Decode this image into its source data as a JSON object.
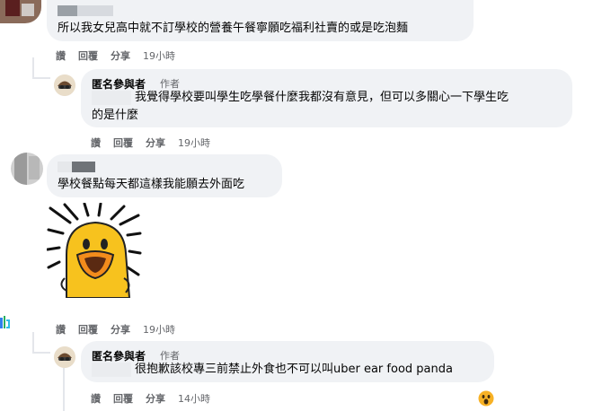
{
  "comments": [
    {
      "text": "所以我女兒高中就不訂學校的營養午餐寧願吃福利社賣的或是吃泡麵",
      "actions": {
        "like": "讚",
        "reply": "回覆",
        "share": "分享"
      },
      "time": "19小時",
      "reply": {
        "author": "匿名參與者",
        "author_tag": "作者",
        "text_line1": "我覺得學校要叫學生吃學餐什麼我都沒有意見，但可以多關心一下學生吃",
        "text_line2": "的是什麼",
        "actions": {
          "like": "讚",
          "reply": "回覆",
          "share": "分享"
        },
        "time": "19小時"
      }
    },
    {
      "text": "學校餐點每天都這樣我能願去外面吃",
      "sticker": "shocked-yellow-duck-sticker",
      "actions": {
        "like": "讚",
        "reply": "回覆",
        "share": "分享"
      },
      "time": "19小時",
      "reply": {
        "author": "匿名參與者",
        "author_tag": "作者",
        "text": "很抱歉該校專三前禁止外食也不可以叫uber ear food panda",
        "actions": {
          "like": "讚",
          "reply": "回覆",
          "share": "分享"
        },
        "time": "14小時",
        "reaction": "wow-emoji"
      }
    }
  ],
  "colors": {
    "bubble": "#f0f2f5",
    "action_text": "#65676b",
    "thread_line": "#e4e6eb",
    "sticker_yellow": "#f7c21e"
  }
}
